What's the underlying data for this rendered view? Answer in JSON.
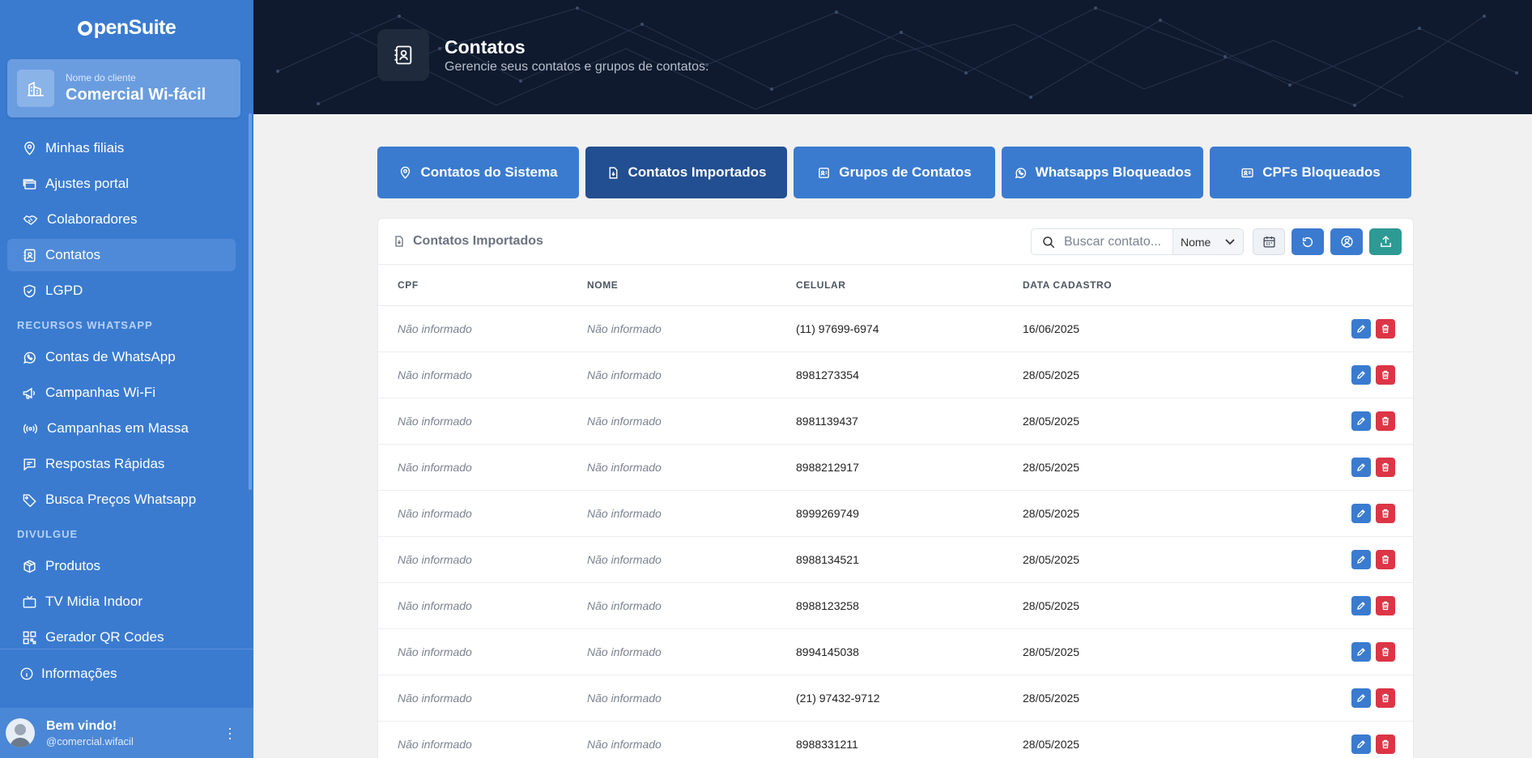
{
  "app": {
    "logo": "penSuite"
  },
  "client": {
    "label": "Nome do cliente",
    "name": "Comercial Wi-fácil"
  },
  "sidebar": {
    "items_main": [
      {
        "label": "Minhas filiais",
        "icon": "map-pin-icon"
      },
      {
        "label": "Ajustes portal",
        "icon": "browser-window-icon"
      },
      {
        "label": "Colaboradores",
        "icon": "handshake-icon"
      },
      {
        "label": "Contatos",
        "icon": "contact-book-icon",
        "active": true
      },
      {
        "label": "LGPD",
        "icon": "shield-check-icon"
      }
    ],
    "section_whatsapp": "RECURSOS WHATSAPP",
    "items_whatsapp": [
      {
        "label": "Contas de WhatsApp",
        "icon": "whatsapp-icon"
      },
      {
        "label": "Campanhas Wi-Fi",
        "icon": "megaphone-icon"
      },
      {
        "label": "Campanhas em Massa",
        "icon": "broadcast-icon"
      },
      {
        "label": "Respostas Rápidas",
        "icon": "chat-lines-icon"
      },
      {
        "label": "Busca Preços Whatsapp",
        "icon": "price-tag-icon"
      }
    ],
    "section_divulgue": "DIVULGUE",
    "items_divulgue": [
      {
        "label": "Produtos",
        "icon": "box-icon"
      },
      {
        "label": "TV Midia Indoor",
        "icon": "tv-icon"
      },
      {
        "label": "Gerador QR Codes",
        "icon": "qr-code-icon"
      }
    ],
    "info_label": "Informações",
    "user": {
      "welcome": "Bem vindo!",
      "handle": "@comercial.wifacil"
    }
  },
  "header": {
    "title": "Contatos",
    "subtitle": "Gerencie seus contatos e grupos de contatos."
  },
  "tabs": [
    {
      "label": "Contatos do Sistema",
      "icon": "map-pin-icon"
    },
    {
      "label": "Contatos Importados",
      "icon": "file-import-icon",
      "active": true
    },
    {
      "label": "Grupos de Contatos",
      "icon": "id-card-icon"
    },
    {
      "label": "Whatsapps Bloqueados",
      "icon": "whatsapp-icon"
    },
    {
      "label": "CPFs Bloqueados",
      "icon": "id-card-icon"
    }
  ],
  "card": {
    "title": "Contatos Importados",
    "search_placeholder": "Buscar contato...",
    "filter_value": "Nome"
  },
  "table": {
    "columns": [
      "CPF",
      "NOME",
      "CELULAR",
      "DATA CADASTRO"
    ],
    "rows": [
      {
        "cpf": "Não informado",
        "nome": "Não informado",
        "celular": "(11) 97699-6974",
        "data": "16/06/2025"
      },
      {
        "cpf": "Não informado",
        "nome": "Não informado",
        "celular": "8981273354",
        "data": "28/05/2025"
      },
      {
        "cpf": "Não informado",
        "nome": "Não informado",
        "celular": "8981139437",
        "data": "28/05/2025"
      },
      {
        "cpf": "Não informado",
        "nome": "Não informado",
        "celular": "8988212917",
        "data": "28/05/2025"
      },
      {
        "cpf": "Não informado",
        "nome": "Não informado",
        "celular": "8999269749",
        "data": "28/05/2025"
      },
      {
        "cpf": "Não informado",
        "nome": "Não informado",
        "celular": "8988134521",
        "data": "28/05/2025"
      },
      {
        "cpf": "Não informado",
        "nome": "Não informado",
        "celular": "8988123258",
        "data": "28/05/2025"
      },
      {
        "cpf": "Não informado",
        "nome": "Não informado",
        "celular": "8994145038",
        "data": "28/05/2025"
      },
      {
        "cpf": "Não informado",
        "nome": "Não informado",
        "celular": "(21) 97432-9712",
        "data": "28/05/2025"
      },
      {
        "cpf": "Não informado",
        "nome": "Não informado",
        "celular": "8988331211",
        "data": "28/05/2025"
      }
    ]
  },
  "colors": {
    "sidebar": "#3a7bd0",
    "tab_active": "#224f91",
    "header_bg": "#0f1a2e",
    "edit_button": "#3a7bd0",
    "delete_button": "#dc3545",
    "export_button": "#2e9a94"
  }
}
